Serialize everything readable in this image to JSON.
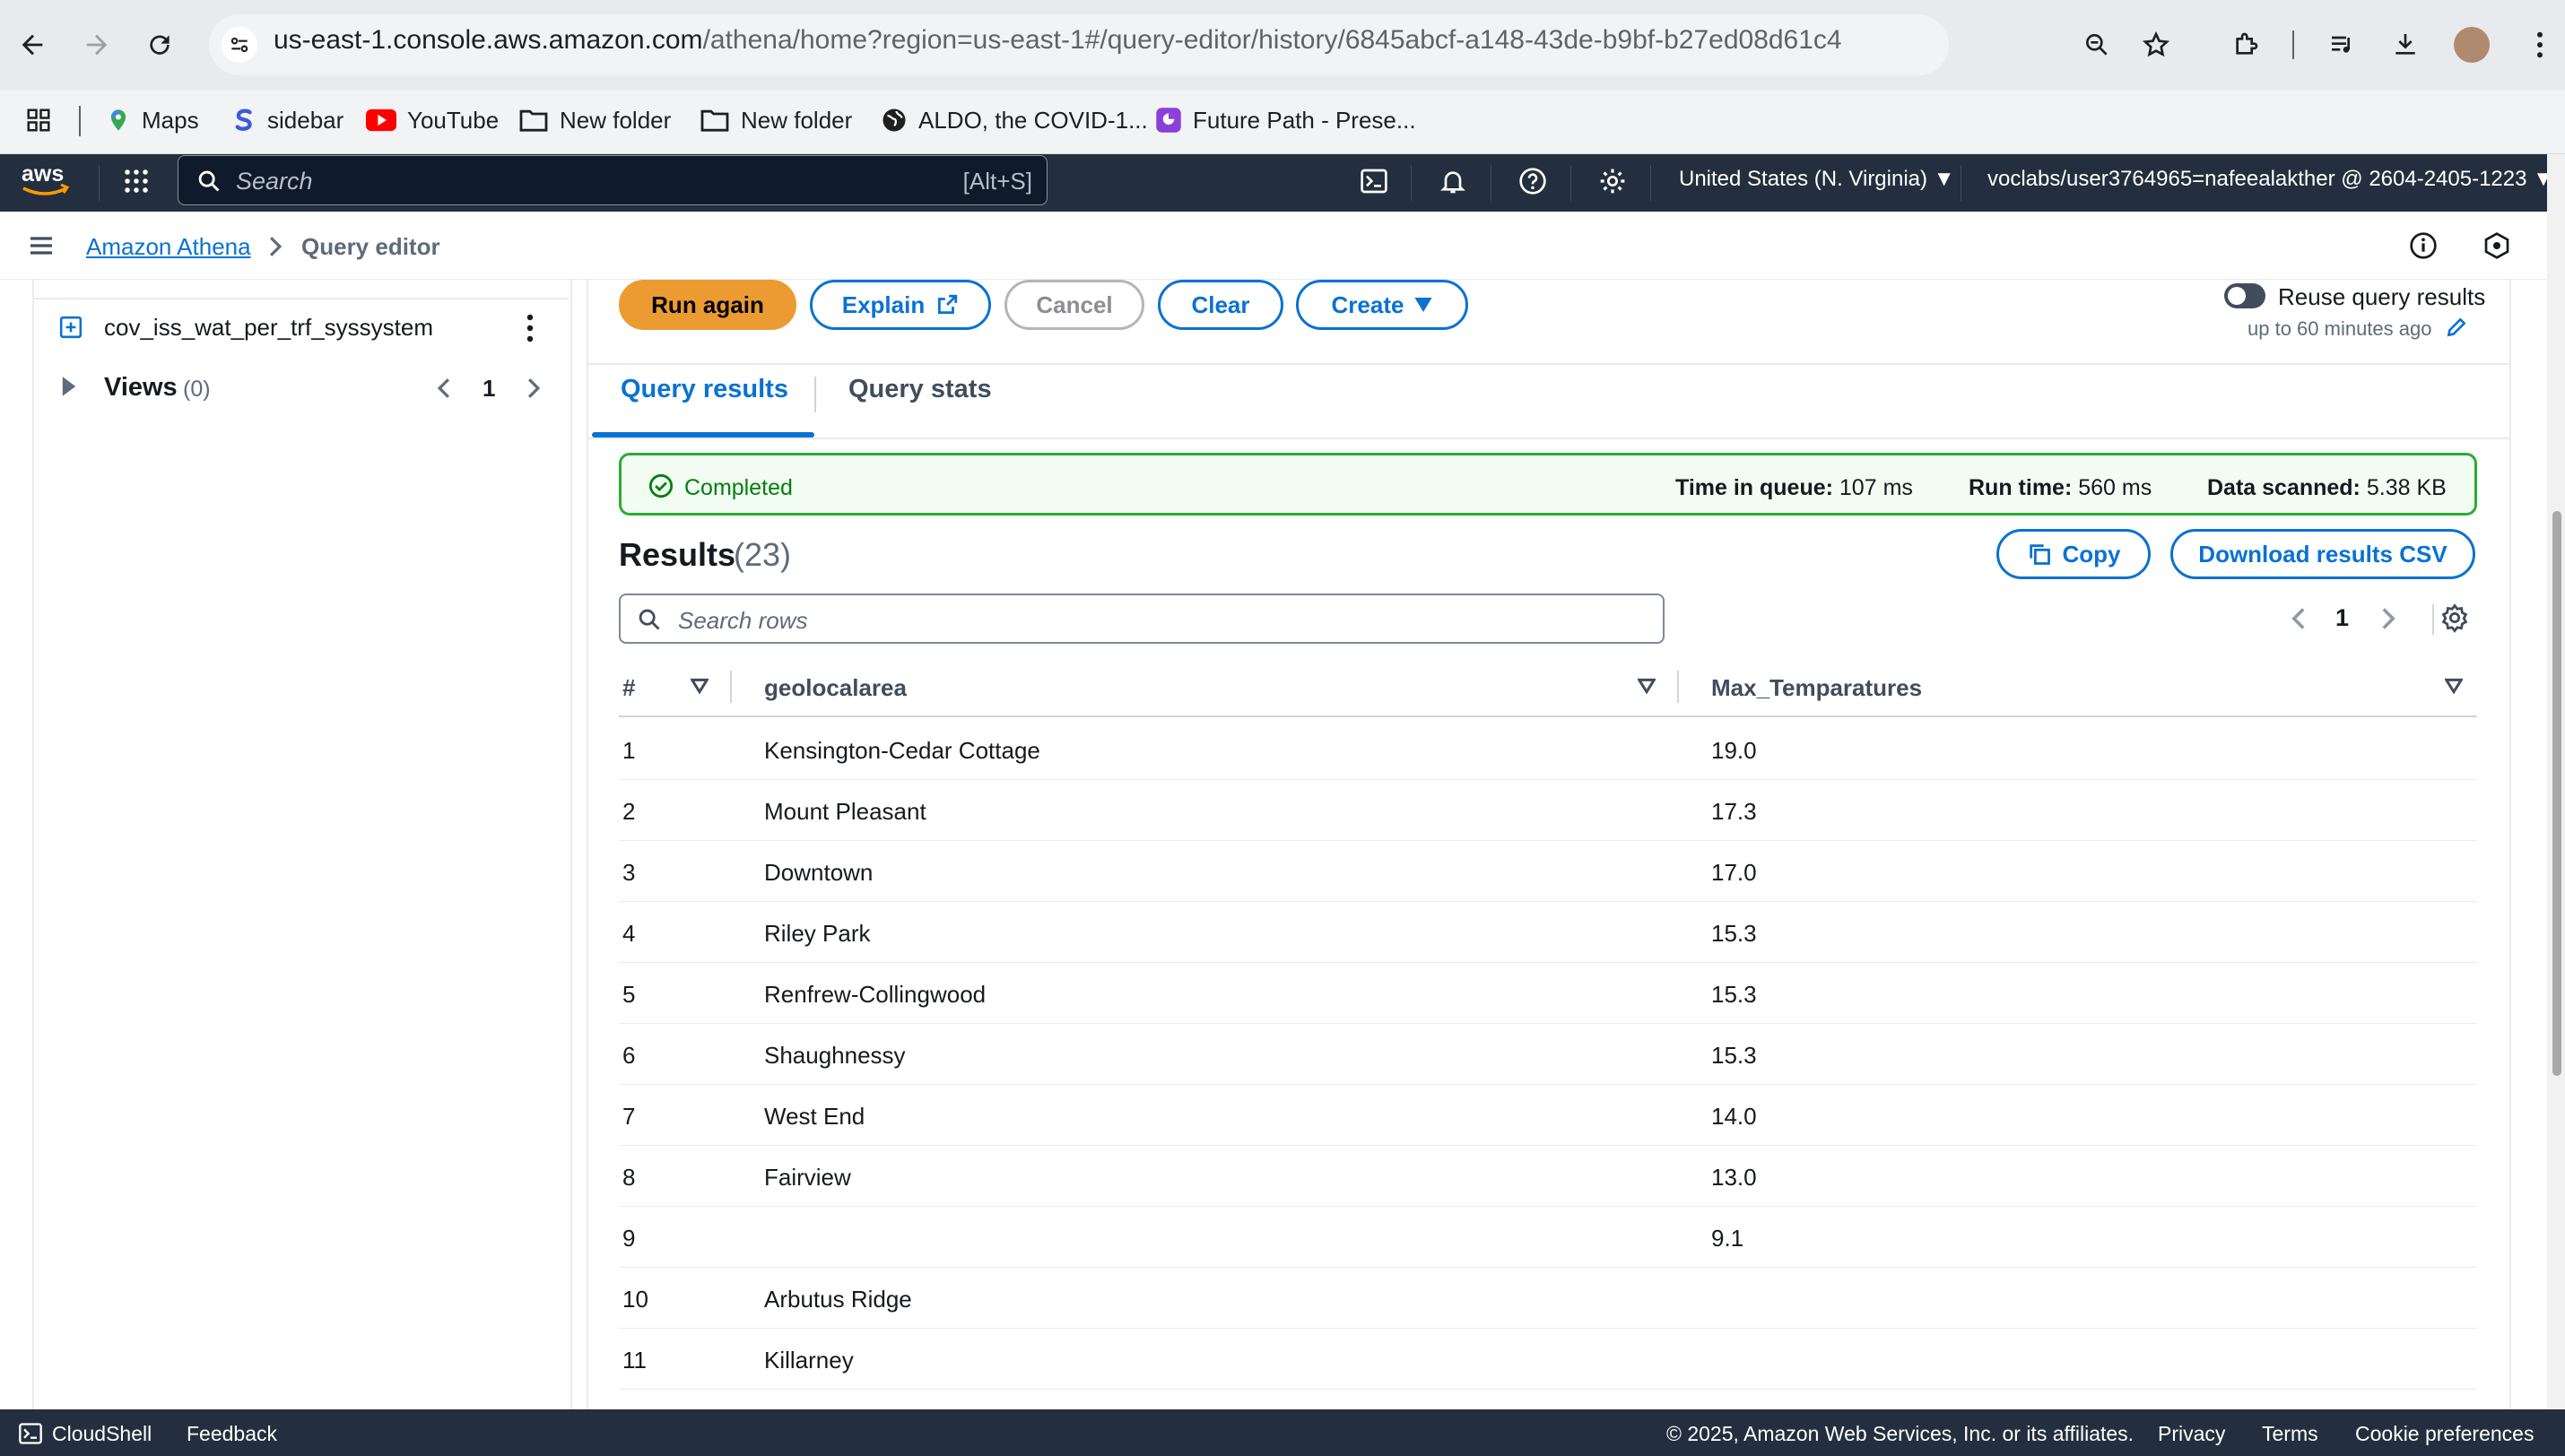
{
  "browser": {
    "url_host": "us-east-1.console.aws.amazon.com",
    "url_path": "/athena/home?region=us-east-1#/query-editor/history/6845abcf-a148-43de-b9bf-b27ed08d61c4",
    "bookmarks": [
      {
        "label": "Maps",
        "icon": "maps-pin-icon"
      },
      {
        "label": "sidebar",
        "icon": "s-logo-icon"
      },
      {
        "label": "YouTube",
        "icon": "youtube-icon"
      },
      {
        "label": "New folder",
        "icon": "folder-icon"
      },
      {
        "label": "New folder",
        "icon": "folder-icon"
      },
      {
        "label": "ALDO, the COVID-1...",
        "icon": "globe-icon"
      },
      {
        "label": "Future Path - Prese...",
        "icon": "app-icon"
      }
    ]
  },
  "awsnav": {
    "logo": "aws",
    "search_placeholder": "Search",
    "search_shortcut": "[Alt+S]",
    "region": "United States (N. Virginia)",
    "account": "voclabs/user3764965=nafeealakther @ 2604-2405-1223"
  },
  "breadcrumb": {
    "service": "Amazon Athena",
    "page": "Query editor"
  },
  "sidebar": {
    "table_item": "cov_iss_wat_per_trf_syssystem",
    "views_label": "Views",
    "views_count": "(0)",
    "page": "1"
  },
  "toolbar": {
    "run_again": "Run again",
    "explain": "Explain",
    "cancel": "Cancel",
    "clear": "Clear",
    "create": "Create",
    "reuse_label": "Reuse query results",
    "reuse_sub": "up to 60 minutes ago"
  },
  "tabs": {
    "results": "Query results",
    "stats": "Query stats"
  },
  "status": {
    "state": "Completed",
    "queue_label": "Time in queue:",
    "queue_value": "107 ms",
    "run_label": "Run time:",
    "run_value": "560 ms",
    "scanned_label": "Data scanned:",
    "scanned_value": "5.38 KB"
  },
  "results": {
    "title": "Results",
    "count": "(23)",
    "copy": "Copy",
    "download": "Download results CSV",
    "search_placeholder": "Search rows",
    "page": "1",
    "columns": [
      "#",
      "geolocalarea",
      "Max_Temparatures"
    ],
    "rows": [
      [
        "1",
        "Kensington-Cedar Cottage",
        "19.0"
      ],
      [
        "2",
        "Mount Pleasant",
        "17.3"
      ],
      [
        "3",
        "Downtown",
        "17.0"
      ],
      [
        "4",
        "Riley Park",
        "15.3"
      ],
      [
        "5",
        "Renfrew-Collingwood",
        "15.3"
      ],
      [
        "6",
        "Shaughnessy",
        "15.3"
      ],
      [
        "7",
        "West End",
        "14.0"
      ],
      [
        "8",
        "Fairview",
        "13.0"
      ],
      [
        "9",
        "",
        "9.1"
      ],
      [
        "10",
        "Arbutus Ridge",
        ""
      ],
      [
        "11",
        "Killarney",
        ""
      ]
    ]
  },
  "footer": {
    "cloudshell": "CloudShell",
    "feedback": "Feedback",
    "copyright": "© 2025, Amazon Web Services, Inc. or its affiliates.",
    "privacy": "Privacy",
    "terms": "Terms",
    "cookies": "Cookie preferences"
  }
}
